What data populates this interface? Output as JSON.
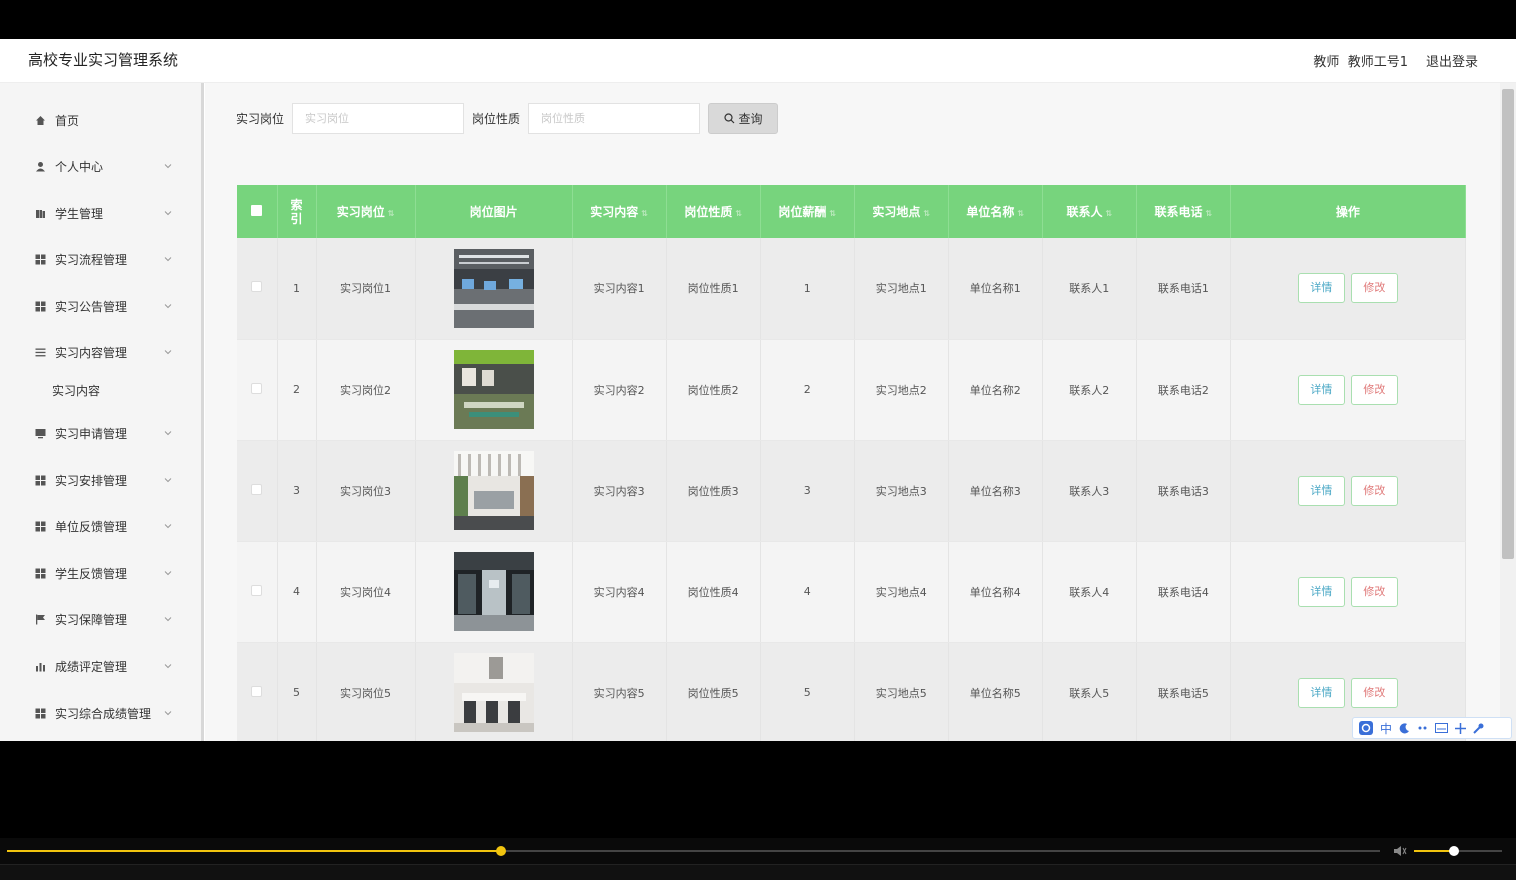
{
  "header": {
    "title": "高校专业实习管理系统",
    "role": "教师",
    "user": "教师工号1",
    "logout": "退出登录"
  },
  "sidebar": {
    "items": [
      {
        "label": "首页",
        "icon": "home-icon"
      },
      {
        "label": "个人中心",
        "icon": "user-icon"
      },
      {
        "label": "学生管理",
        "icon": "book-icon"
      },
      {
        "label": "实习流程管理",
        "icon": "grid-icon"
      },
      {
        "label": "实习公告管理",
        "icon": "grid-icon"
      },
      {
        "label": "实习内容管理",
        "icon": "list-icon"
      },
      {
        "label": "实习申请管理",
        "icon": "monitor-icon"
      },
      {
        "label": "实习安排管理",
        "icon": "grid-icon"
      },
      {
        "label": "单位反馈管理",
        "icon": "grid-icon"
      },
      {
        "label": "学生反馈管理",
        "icon": "grid-icon"
      },
      {
        "label": "实习保障管理",
        "icon": "flag-icon"
      },
      {
        "label": "成绩评定管理",
        "icon": "chart-icon"
      },
      {
        "label": "实习综合成绩管理",
        "icon": "grid-icon"
      }
    ],
    "sub_item": "实习内容"
  },
  "search": {
    "field1_label": "实习岗位",
    "field1_placeholder": "实习岗位",
    "field2_label": "岗位性质",
    "field2_placeholder": "岗位性质",
    "query_button": "查询"
  },
  "table": {
    "headers": [
      "索引",
      "实习岗位",
      "岗位图片",
      "实习内容",
      "岗位性质",
      "岗位薪酬",
      "实习地点",
      "单位名称",
      "联系人",
      "联系电话",
      "操作"
    ],
    "rows": [
      {
        "index": "1",
        "post": "实习岗位1",
        "content": "实习内容1",
        "nature": "岗位性质1",
        "salary": "1",
        "location": "实习地点1",
        "company": "单位名称1",
        "contact": "联系人1",
        "phone": "联系电话1"
      },
      {
        "index": "2",
        "post": "实习岗位2",
        "content": "实习内容2",
        "nature": "岗位性质2",
        "salary": "2",
        "location": "实习地点2",
        "company": "单位名称2",
        "contact": "联系人2",
        "phone": "联系电话2"
      },
      {
        "index": "3",
        "post": "实习岗位3",
        "content": "实习内容3",
        "nature": "岗位性质3",
        "salary": "3",
        "location": "实习地点3",
        "company": "单位名称3",
        "contact": "联系人3",
        "phone": "联系电话3"
      },
      {
        "index": "4",
        "post": "实习岗位4",
        "content": "实习内容4",
        "nature": "岗位性质4",
        "salary": "4",
        "location": "实习地点4",
        "company": "单位名称4",
        "contact": "联系人4",
        "phone": "联系电话4"
      },
      {
        "index": "5",
        "post": "实习岗位5",
        "content": "实习内容5",
        "nature": "岗位性质5",
        "salary": "5",
        "location": "实习地点5",
        "company": "单位名称5",
        "contact": "联系人5",
        "phone": "联系电话5"
      }
    ],
    "detail_button": "详情",
    "edit_button": "修改"
  },
  "ime": {
    "label": "中"
  },
  "player": {
    "progress": 0.36,
    "volume": 0.45
  }
}
